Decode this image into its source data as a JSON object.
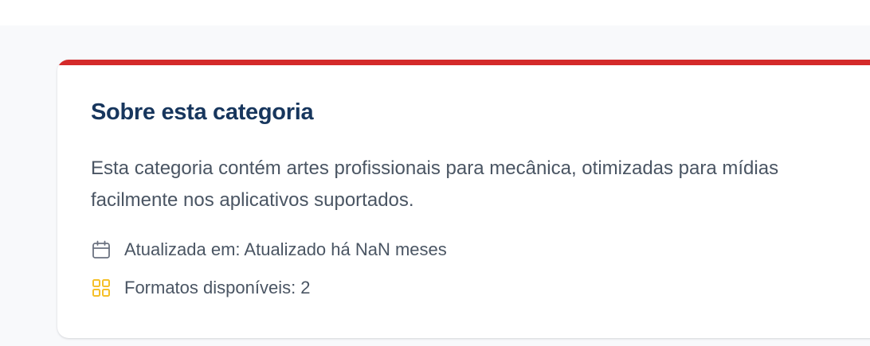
{
  "category_card": {
    "title": "Sobre esta categoria",
    "description": "Esta categoria contém artes profissionais para mecânica, otimizadas para mídias facilmente nos aplicativos suportados.",
    "description_line1": "Esta categoria contém artes profissionais para mecânica, otimizadas para mídias",
    "description_line2": "facilmente nos aplicativos suportados.",
    "updated_text": "Atualizada em: Atualizado há NaN meses",
    "formats_text": "Formatos disponíveis: 2",
    "accent_color": "#d42a2a",
    "title_color": "#17365d",
    "formats_icon_color": "#f5c02a",
    "icons": {
      "updated": "calendar-icon",
      "formats": "grid-icon"
    }
  }
}
